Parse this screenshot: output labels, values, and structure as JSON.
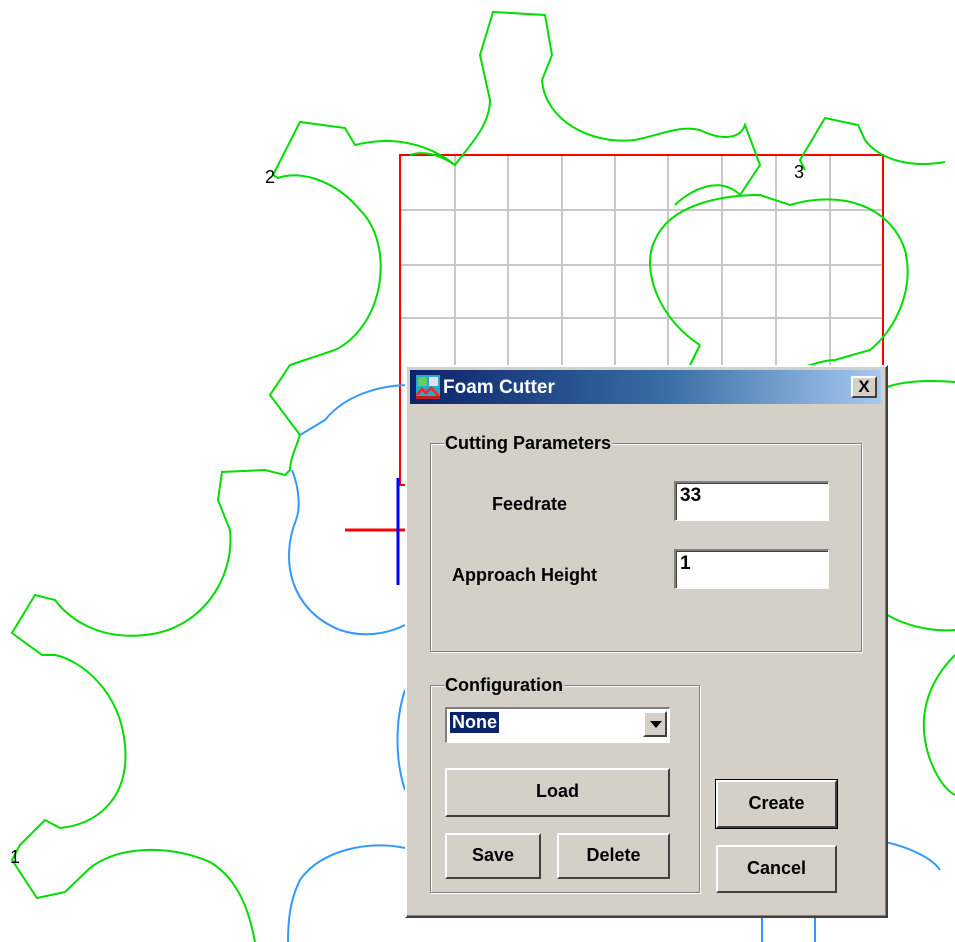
{
  "point_labels": [
    "1",
    "2",
    "3"
  ],
  "colors": {
    "gear": "#00dd00",
    "gear_alt": "#3399ff",
    "box": "#ff0000",
    "grid": "#c8c8c8",
    "axis_x": "#ff0000",
    "axis_y": "#0000ff"
  },
  "dialog": {
    "title": "Foam Cutter",
    "close_label": "X",
    "app_icon": "foam-cutter-app-icon",
    "cutting": {
      "legend": "Cutting Parameters",
      "feedrate_label": "Feedrate",
      "feedrate_value": "33",
      "approach_label": "Approach Height",
      "approach_value": "1"
    },
    "configuration": {
      "legend": "Configuration",
      "selected": "None",
      "load_label": "Load",
      "save_label": "Save",
      "delete_label": "Delete"
    },
    "create_label": "Create",
    "cancel_label": "Cancel"
  }
}
